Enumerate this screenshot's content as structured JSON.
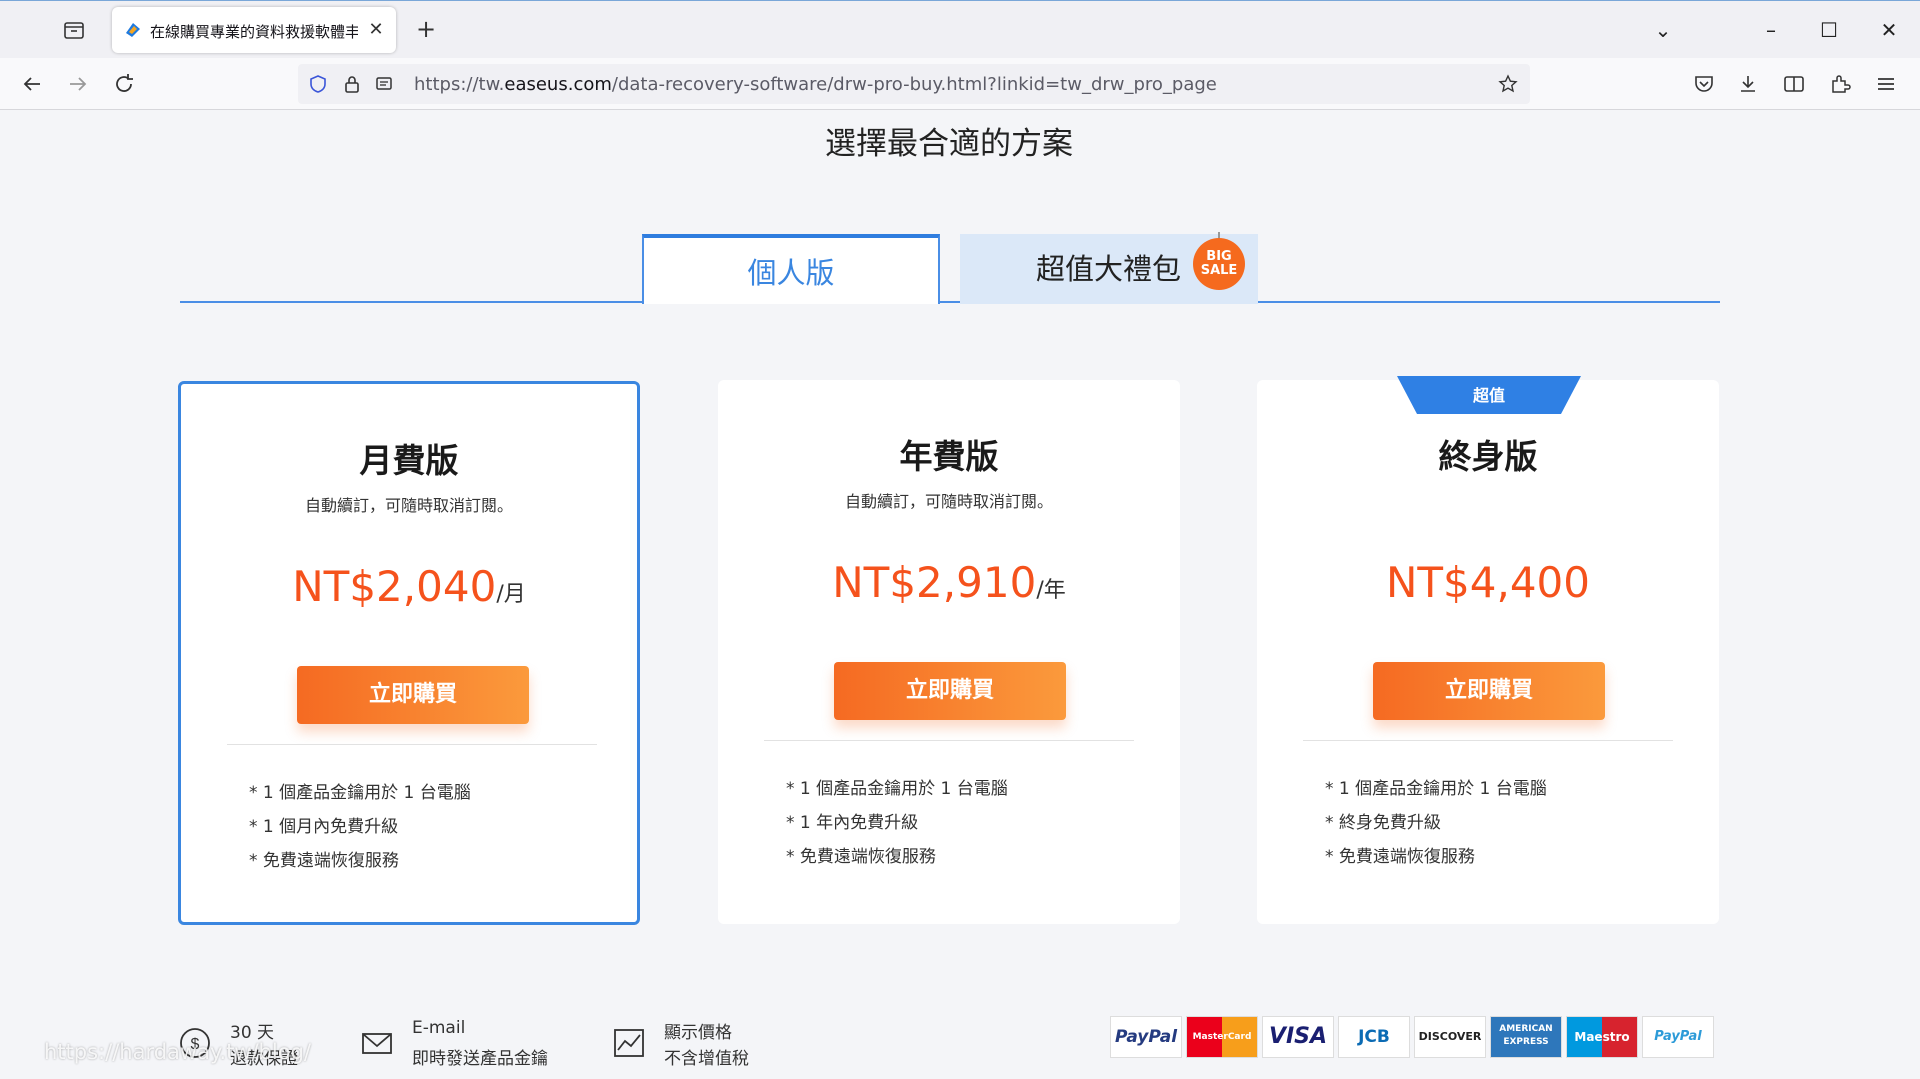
{
  "browser": {
    "tab_title": "在線購買專業的資料救援軟體丰",
    "url_prefix": "https://tw.",
    "url_host": "easeus.com",
    "url_path": "/data-recovery-software/drw-pro-buy.html?linkid=tw_drw_pro_page"
  },
  "page": {
    "title": "選擇最合適的方案",
    "tabs": {
      "personal": "個人版",
      "bundle": "超值大禮包",
      "badge_line1": "BIG",
      "badge_line2": "SALE"
    }
  },
  "cards": [
    {
      "name": "月費版",
      "desc": "自動續訂，可隨時取消訂閱。",
      "price": "NT$2,040",
      "unit": "/月",
      "button": "立即購買",
      "features": [
        "* 1 個產品金鑰用於 1 台電腦",
        "* 1 個月內免費升級",
        "* 免費遠端恢復服務"
      ]
    },
    {
      "name": "年費版",
      "desc": "自動續訂，可隨時取消訂閱。",
      "price": "NT$2,910",
      "unit": "/年",
      "button": "立即購買",
      "features": [
        "* 1 個產品金鑰用於 1 台電腦",
        "* 1 年內免費升級",
        "* 免費遠端恢復服務"
      ]
    },
    {
      "ribbon": "超值",
      "name": "終身版",
      "price": "NT$4,400",
      "button": "立即購買",
      "features": [
        "* 1 個產品金鑰用於 1 台電腦",
        "* 終身免費升級",
        "* 免費遠端恢復服務"
      ]
    }
  ],
  "footer": {
    "guarantee_line1": "30 天",
    "guarantee_line2": "退款保證",
    "email_line1": "E-mail",
    "email_line2": "即時發送產品金鑰",
    "tax_line1": "顯示價格",
    "tax_line2": "不含增值稅",
    "payments": [
      "PayPal",
      "MasterCard",
      "VISA",
      "JCB",
      "DISCOVER",
      "AMERICAN EXPRESS",
      "Maestro",
      "PayPal"
    ]
  },
  "watermark": "https://hardaway.tw/blog/",
  "colors": {
    "accent_blue": "#3a86e0",
    "price_orange": "#f5521c",
    "button_orange": "#f56a22"
  }
}
